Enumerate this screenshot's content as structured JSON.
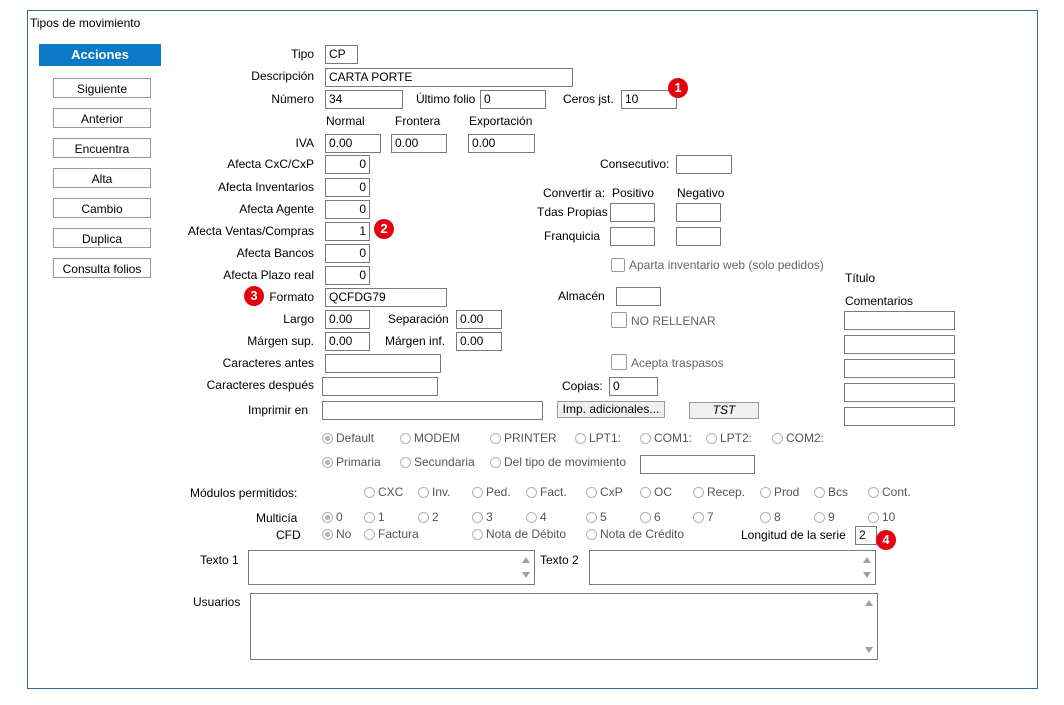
{
  "window": {
    "title": "Tipos de movimiento"
  },
  "sidebar": {
    "header": "Acciones",
    "buttons": [
      "Siguiente",
      "Anterior",
      "Encuentra",
      "Alta",
      "Cambio",
      "Duplica",
      "Consulta folios"
    ]
  },
  "form": {
    "tipo": {
      "label": "Tipo",
      "value": "CP"
    },
    "descripcion": {
      "label": "Descripción",
      "value": "CARTA PORTE"
    },
    "numero": {
      "label": "Número",
      "value": "34"
    },
    "ultimo_folio": {
      "label": "Último folio",
      "value": "0"
    },
    "ceros": {
      "label": "Ceros jst.",
      "value": "10"
    },
    "iva": {
      "label": "IVA",
      "col_normal": "Normal",
      "col_frontera": "Frontera",
      "col_exportacion": "Exportación",
      "normal": "0.00",
      "frontera": "0.00",
      "exportacion": "0.00"
    },
    "afecta_cxc": {
      "label": "Afecta  CxC/CxP",
      "value": "0"
    },
    "afecta_inv": {
      "label": "Afecta  Inventarios",
      "value": "0"
    },
    "afecta_agente": {
      "label": "Afecta  Agente",
      "value": "0"
    },
    "afecta_ventas": {
      "label": "Afecta  Ventas/Compras",
      "value": "1"
    },
    "afecta_bancos": {
      "label": "Afecta  Bancos",
      "value": "0"
    },
    "afecta_plazo": {
      "label": "Afecta  Plazo real",
      "value": "0"
    },
    "formato": {
      "label": "Formato",
      "value": "QCFDG79"
    },
    "largo": {
      "label": "Largo",
      "value": "0.00"
    },
    "separacion": {
      "label": "Separación",
      "value": "0.00"
    },
    "margen_sup": {
      "label": "Márgen sup.",
      "value": "0.00"
    },
    "margen_inf": {
      "label": "Márgen inf.",
      "value": "0.00"
    },
    "car_antes": {
      "label": "Caracteres antes",
      "value": ""
    },
    "car_despues": {
      "label": "Caracteres después",
      "value": ""
    },
    "imprimir_en": {
      "label": "Imprimir en",
      "value": ""
    },
    "consecutivo": {
      "label": "Consecutivo:",
      "value": ""
    },
    "convertir": {
      "label": "Convertir a:",
      "positivo": "Positivo",
      "negativo": "Negativo"
    },
    "tdas_propias": {
      "label": "Tdas Propias"
    },
    "franquicia": {
      "label": "Franquicia"
    },
    "aparta": {
      "label": "Aparta inventario web (solo pedidos)"
    },
    "almacen": {
      "label": "Almacén",
      "value": ""
    },
    "no_rellenar": {
      "label": "NO RELLENAR"
    },
    "acepta_traspasos": {
      "label": "Acepta traspasos"
    },
    "copias": {
      "label": "Copias:",
      "value": "0"
    },
    "imp_adicionales": "Imp. adicionales...",
    "tst": "TST",
    "titulo": "Título",
    "comentarios": "Comentarios"
  },
  "ports": [
    "Default",
    "MODEM",
    "PRINTER",
    "LPT1:",
    "COM1:",
    "LPT2:",
    "COM2:"
  ],
  "printer_source": [
    "Primaria",
    "Secundaria",
    "Del tipo de movimiento"
  ],
  "modulos": {
    "label": "Módulos permitidos:",
    "items": [
      "CXC",
      "Inv.",
      "Ped.",
      "Fact.",
      "CxP",
      "OC",
      "Recep.",
      "Prod",
      "Bcs",
      "Cont."
    ]
  },
  "multicia": {
    "label": "Multicía",
    "items": [
      "0",
      "1",
      "2",
      "3",
      "4",
      "5",
      "6",
      "7",
      "8",
      "9",
      "10"
    ]
  },
  "cfd": {
    "label": "CFD",
    "items": [
      "No",
      "Factura",
      "Nota de Débito",
      "Nota de Crédito"
    ]
  },
  "longitud_serie": {
    "label": "Longitud de la serie",
    "value": "2"
  },
  "texto1": {
    "label": "Texto 1"
  },
  "texto2": {
    "label": "Texto 2"
  },
  "usuarios": {
    "label": "Usuarios"
  },
  "badges": [
    "1",
    "2",
    "3",
    "4"
  ],
  "colors": {
    "accent": "#0b79c6",
    "badge": "#e3000f",
    "frame": "#2e6c9a"
  }
}
